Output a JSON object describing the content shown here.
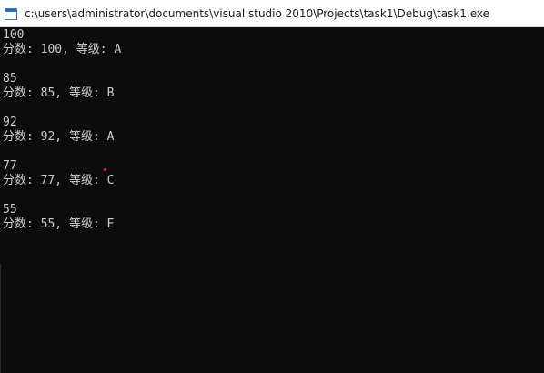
{
  "window": {
    "title": "c:\\users\\administrator\\documents\\visual studio 2010\\Projects\\task1\\Debug\\task1.exe",
    "icon": "console-app-icon"
  },
  "console": {
    "lines": [
      "100",
      "分数: 100, 等级: A",
      "",
      "85",
      "分数: 85, 等级: B",
      "",
      "92",
      "分数: 92, 等级: A",
      "",
      "77",
      "分数: 77, 等级: C",
      "",
      "55",
      "分数: 55, 等级: E"
    ]
  },
  "colors": {
    "console_bg": "#0c0c0c",
    "console_text": "#cccccc",
    "titlebar_bg": "#ffffff"
  }
}
